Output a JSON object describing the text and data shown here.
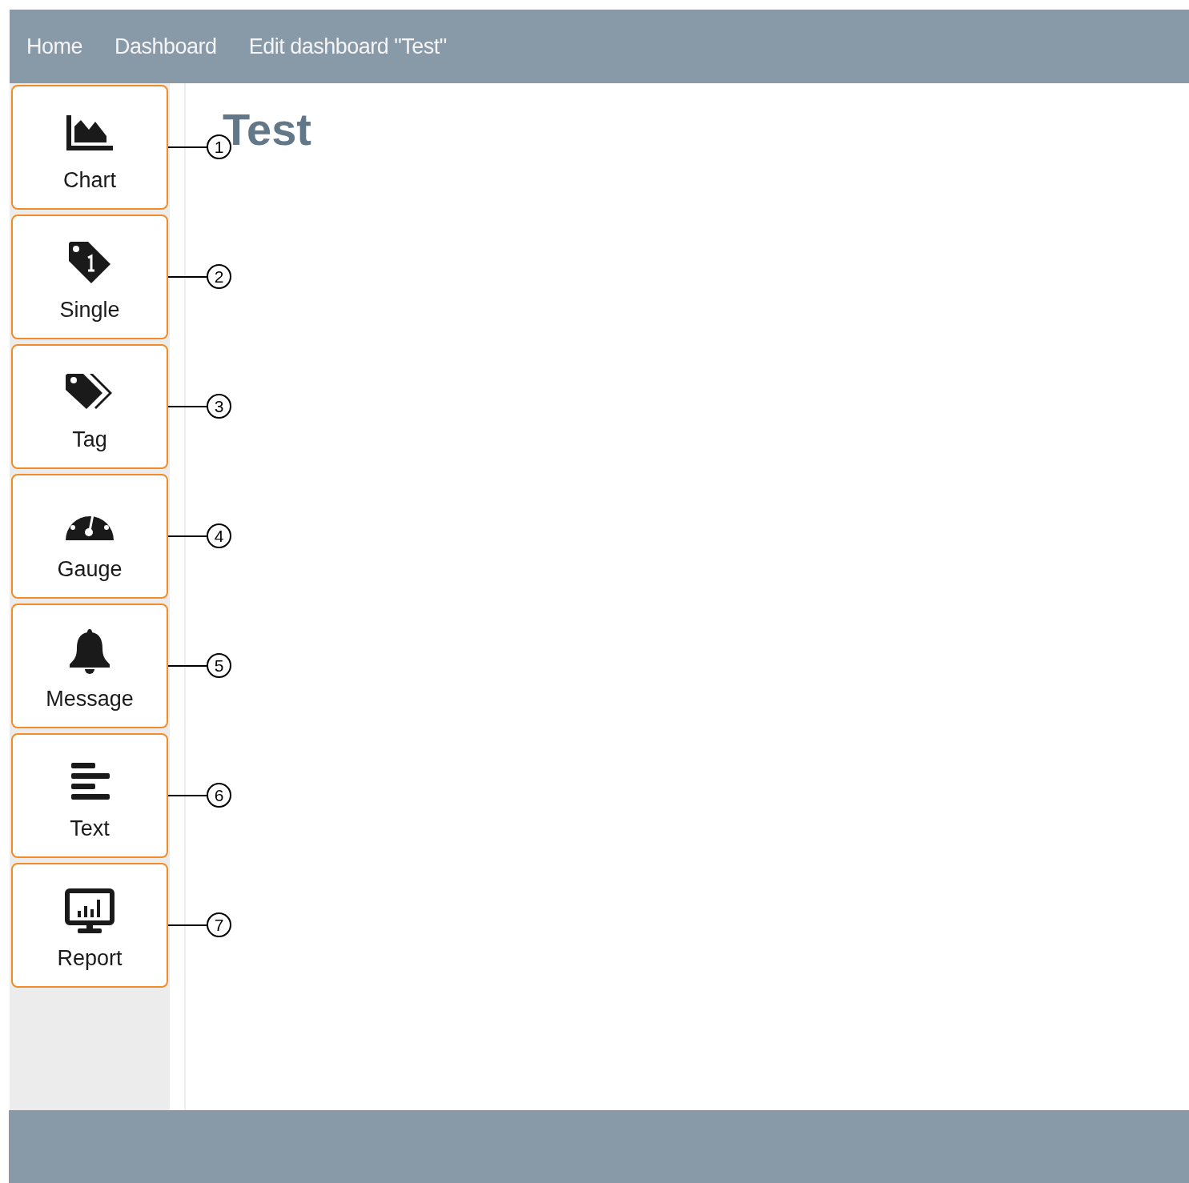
{
  "nav": {
    "links": [
      {
        "label": "Home"
      },
      {
        "label": "Dashboard"
      },
      {
        "label": "Edit dashboard \"Test\""
      }
    ]
  },
  "widgets": [
    {
      "kind": "chart",
      "label": "Chart",
      "callout": "1"
    },
    {
      "kind": "single",
      "label": "Single",
      "callout": "2"
    },
    {
      "kind": "tag",
      "label": "Tag",
      "callout": "3"
    },
    {
      "kind": "gauge",
      "label": "Gauge",
      "callout": "4"
    },
    {
      "kind": "message",
      "label": "Message",
      "callout": "5"
    },
    {
      "kind": "text",
      "label": "Text",
      "callout": "6"
    },
    {
      "kind": "report",
      "label": "Report",
      "callout": "7"
    }
  ],
  "dashboard": {
    "title": "Test"
  }
}
